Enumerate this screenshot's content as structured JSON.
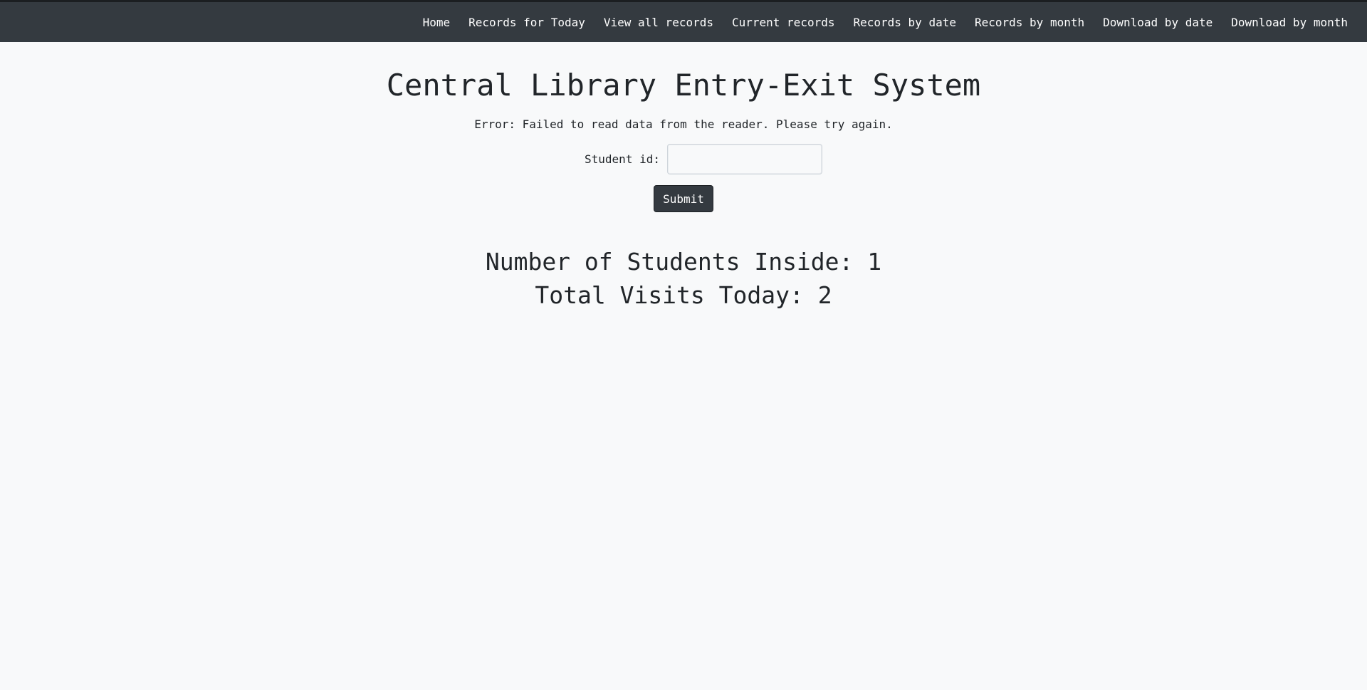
{
  "nav": {
    "items": [
      {
        "label": "Home"
      },
      {
        "label": "Records for Today"
      },
      {
        "label": "View all records"
      },
      {
        "label": "Current records"
      },
      {
        "label": "Records by date"
      },
      {
        "label": "Records by month"
      },
      {
        "label": "Download by date"
      },
      {
        "label": "Download by month"
      }
    ]
  },
  "main": {
    "title": "Central Library Entry-Exit System",
    "error_message": "Error: Failed to read data from the reader. Please try again.",
    "form": {
      "student_id_label": "Student id:",
      "student_id_value": "",
      "student_id_placeholder": "",
      "submit_label": "Submit"
    },
    "stats": {
      "students_inside": "Number of Students Inside: 1",
      "total_visits": "Total Visits Today: 2"
    }
  },
  "colors": {
    "navbar_bg": "#343a40",
    "page_bg": "#f8f9fa",
    "button_bg": "#343a40"
  }
}
